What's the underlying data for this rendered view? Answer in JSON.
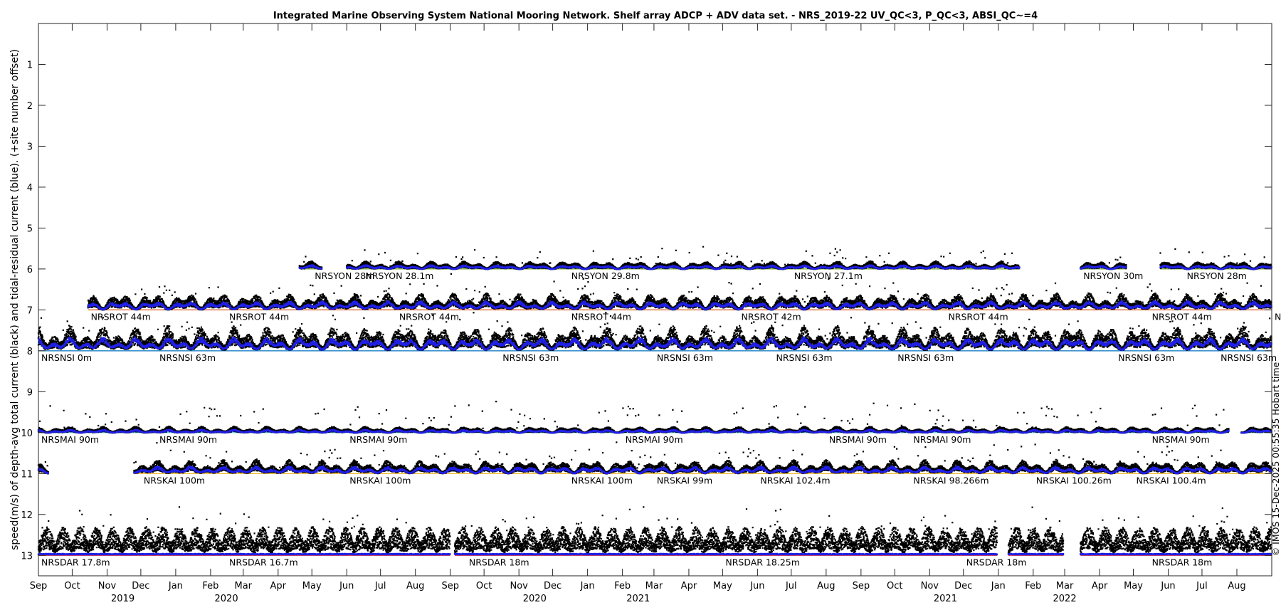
{
  "chart_data": {
    "type": "scatter",
    "title": "Integrated Marine Observing System National Mooring Network. Shelf array ADCP + ADV data set. - NRS_2019-22 UV_QC<3, P_QC<3, ABSI_QC~=4",
    "ylabel": "speed(m/s) of depth-avg total current (black) and tidal-residual current (blue). (+site number offset)",
    "right_label": "© IMOS 15-Dec-2025 00:55:35 Hobart time",
    "xlim": [
      "2019-09-01",
      "2022-09-01"
    ],
    "ylim": [
      0,
      13.5
    ],
    "y_reversed": true,
    "grid": false,
    "y_ticks": [
      1,
      2,
      3,
      4,
      5,
      6,
      7,
      8,
      9,
      10,
      11,
      12,
      13
    ],
    "x_ticks": [
      {
        "date": "2019-09-01",
        "label": "Sep"
      },
      {
        "date": "2019-10-01",
        "label": "Oct"
      },
      {
        "date": "2019-11-01",
        "label": "Nov"
      },
      {
        "date": "2019-12-01",
        "label": "Dec"
      },
      {
        "date": "2020-01-01",
        "label": "Jan"
      },
      {
        "date": "2020-02-01",
        "label": "Feb"
      },
      {
        "date": "2020-03-01",
        "label": "Mar"
      },
      {
        "date": "2020-04-01",
        "label": "Apr"
      },
      {
        "date": "2020-05-01",
        "label": "May"
      },
      {
        "date": "2020-06-01",
        "label": "Jun"
      },
      {
        "date": "2020-07-01",
        "label": "Jul"
      },
      {
        "date": "2020-08-01",
        "label": "Aug"
      },
      {
        "date": "2020-09-01",
        "label": "Sep"
      },
      {
        "date": "2020-10-01",
        "label": "Oct"
      },
      {
        "date": "2020-11-01",
        "label": "Nov"
      },
      {
        "date": "2020-12-01",
        "label": "Dec"
      },
      {
        "date": "2021-01-01",
        "label": "Jan"
      },
      {
        "date": "2021-02-01",
        "label": "Feb"
      },
      {
        "date": "2021-03-01",
        "label": "Mar"
      },
      {
        "date": "2021-04-01",
        "label": "Apr"
      },
      {
        "date": "2021-05-01",
        "label": "May"
      },
      {
        "date": "2021-06-01",
        "label": "Jun"
      },
      {
        "date": "2021-07-01",
        "label": "Jul"
      },
      {
        "date": "2021-08-01",
        "label": "Aug"
      },
      {
        "date": "2021-09-01",
        "label": "Sep"
      },
      {
        "date": "2021-10-01",
        "label": "Oct"
      },
      {
        "date": "2021-11-01",
        "label": "Nov"
      },
      {
        "date": "2021-12-01",
        "label": "Dec"
      },
      {
        "date": "2022-01-01",
        "label": "Jan"
      },
      {
        "date": "2022-02-01",
        "label": "Feb"
      },
      {
        "date": "2022-03-01",
        "label": "Mar"
      },
      {
        "date": "2022-04-01",
        "label": "Apr"
      },
      {
        "date": "2022-05-01",
        "label": "May"
      },
      {
        "date": "2022-06-01",
        "label": "Jun"
      },
      {
        "date": "2022-07-01",
        "label": "Jul"
      },
      {
        "date": "2022-08-01",
        "label": "Aug"
      }
    ],
    "year_labels": [
      {
        "date": "2019-11-15",
        "label": "2019"
      },
      {
        "date": "2020-02-15",
        "label": "2020"
      },
      {
        "date": "2020-11-15",
        "label": "2020"
      },
      {
        "date": "2021-02-15",
        "label": "2021"
      },
      {
        "date": "2021-11-15",
        "label": "2021"
      },
      {
        "date": "2022-03-01",
        "label": "2022"
      }
    ],
    "station_labels": [
      {
        "date": "2020-05-01",
        "offset": 6,
        "label": "NRSYON 28m"
      },
      {
        "date": "2020-06-15",
        "offset": 6,
        "label": "NRSYON 28.1m"
      },
      {
        "date": "2020-12-15",
        "offset": 6,
        "label": "NRSYON 29.8m"
      },
      {
        "date": "2021-07-01",
        "offset": 6,
        "label": "NRSYON 27.1m"
      },
      {
        "date": "2022-03-15",
        "offset": 6,
        "label": "NRSYON 30m"
      },
      {
        "date": "2022-06-15",
        "offset": 6,
        "label": "NRSYON 28m"
      },
      {
        "date": "2019-10-15",
        "offset": 7,
        "label": "NRSROT 44m"
      },
      {
        "date": "2020-02-15",
        "offset": 7,
        "label": "NRSROT 44m"
      },
      {
        "date": "2020-07-15",
        "offset": 7,
        "label": "NRSROT 44m"
      },
      {
        "date": "2020-12-15",
        "offset": 7,
        "label": "NRSROT 44m"
      },
      {
        "date": "2021-05-15",
        "offset": 7,
        "label": "NRSROT 42m"
      },
      {
        "date": "2021-11-15",
        "offset": 7,
        "label": "NRSROT 44m"
      },
      {
        "date": "2022-05-15",
        "offset": 7,
        "label": "NRSROT 44m"
      },
      {
        "date": "2022-09-01",
        "offset": 7,
        "label": "NRS"
      },
      {
        "date": "2019-09-01",
        "offset": 8,
        "label": "NRSNSI 0m"
      },
      {
        "date": "2019-12-15",
        "offset": 8,
        "label": "NRSNSI 63m"
      },
      {
        "date": "2020-10-15",
        "offset": 8,
        "label": "NRSNSI 63m"
      },
      {
        "date": "2021-03-01",
        "offset": 8,
        "label": "NRSNSI 63m"
      },
      {
        "date": "2021-06-15",
        "offset": 8,
        "label": "NRSNSI 63m"
      },
      {
        "date": "2021-10-01",
        "offset": 8,
        "label": "NRSNSI 63m"
      },
      {
        "date": "2022-04-15",
        "offset": 8,
        "label": "NRSNSI 63m"
      },
      {
        "date": "2022-07-15",
        "offset": 8,
        "label": "NRSNSI 63m"
      },
      {
        "date": "2019-09-01",
        "offset": 10,
        "label": "NRSMAI 90m"
      },
      {
        "date": "2019-12-15",
        "offset": 10,
        "label": "NRSMAI 90m"
      },
      {
        "date": "2020-06-01",
        "offset": 10,
        "label": "NRSMAI 90m"
      },
      {
        "date": "2021-02-01",
        "offset": 10,
        "label": "NRSMAI 90m"
      },
      {
        "date": "2021-08-01",
        "offset": 10,
        "label": "NRSMAI 90m"
      },
      {
        "date": "2021-10-15",
        "offset": 10,
        "label": "NRSMAI 90m"
      },
      {
        "date": "2022-05-15",
        "offset": 10,
        "label": "NRSMAI 90m"
      },
      {
        "date": "2019-12-01",
        "offset": 11,
        "label": "NRSKAI 100m"
      },
      {
        "date": "2020-06-01",
        "offset": 11,
        "label": "NRSKAI 100m"
      },
      {
        "date": "2020-12-15",
        "offset": 11,
        "label": "NRSKAI 100m"
      },
      {
        "date": "2021-03-01",
        "offset": 11,
        "label": "NRSKAI 99m"
      },
      {
        "date": "2021-06-01",
        "offset": 11,
        "label": "NRSKAI 102.4m"
      },
      {
        "date": "2021-10-15",
        "offset": 11,
        "label": "NRSKAI 98.266m"
      },
      {
        "date": "2022-02-01",
        "offset": 11,
        "label": "NRSKAI 100.26m"
      },
      {
        "date": "2022-05-01",
        "offset": 11,
        "label": "NRSKAI 100.4m"
      },
      {
        "date": "2019-09-01",
        "offset": 13,
        "label": "NRSDAR 17.8m"
      },
      {
        "date": "2020-02-15",
        "offset": 13,
        "label": "NRSDAR 16.7m"
      },
      {
        "date": "2020-09-15",
        "offset": 13,
        "label": "NRSDAR 18m"
      },
      {
        "date": "2021-05-01",
        "offset": 13,
        "label": "NRSDAR 18.25m"
      },
      {
        "date": "2021-12-01",
        "offset": 13,
        "label": "NRSDAR 18m"
      },
      {
        "date": "2022-05-15",
        "offset": 13,
        "label": "NRSDAR 18m"
      }
    ],
    "series": [
      {
        "name": "NRSYON",
        "offset": 6,
        "base_color": "#77ac30",
        "segments": [
          [
            "2020-04-20",
            "2020-05-10"
          ],
          [
            "2020-06-01",
            "2022-01-20"
          ],
          [
            "2022-03-15",
            "2022-04-25"
          ],
          [
            "2022-05-25",
            "2022-09-01"
          ]
        ],
        "total_speed_typical": 0.15,
        "total_speed_max": 0.7,
        "tide_period_days": 0
      },
      {
        "name": "NRSROT",
        "offset": 7,
        "base_color": "#d95319",
        "segments": [
          [
            "2019-10-15",
            "2022-09-01"
          ]
        ],
        "total_speed_typical": 0.3,
        "total_speed_max": 0.9,
        "tide_period_days": 0
      },
      {
        "name": "NRSNSI",
        "offset": 8,
        "base_color": "#0072bd",
        "segments": [
          [
            "2019-09-01",
            "2022-09-01"
          ]
        ],
        "total_speed_typical": 0.45,
        "total_speed_max": 0.95,
        "tide_period_days": 0
      },
      {
        "name": "NRSMAI",
        "offset": 10,
        "base_color": "#4dbeee",
        "segments": [
          [
            "2019-09-01",
            "2022-07-25"
          ],
          [
            "2022-08-05",
            "2022-09-01"
          ]
        ],
        "total_speed_typical": 0.12,
        "total_speed_max": 1.1,
        "tide_period_days": 0
      },
      {
        "name": "NRSKAI",
        "offset": 11,
        "base_color": "#edb120",
        "segments": [
          [
            "2019-09-01",
            "2019-09-10"
          ],
          [
            "2019-11-25",
            "2022-09-01"
          ]
        ],
        "total_speed_typical": 0.25,
        "total_speed_max": 0.9,
        "tide_period_days": 0
      },
      {
        "name": "NRSDAR",
        "offset": 13,
        "base_color": "#d62728",
        "segments": [
          [
            "2019-09-01",
            "2020-09-01"
          ],
          [
            "2020-09-05",
            "2021-12-31"
          ],
          [
            "2022-01-10",
            "2022-02-28"
          ],
          [
            "2022-03-15",
            "2022-09-01"
          ]
        ],
        "total_speed_typical": 0.6,
        "total_speed_max": 1.2,
        "tide_period_days": 14.77
      }
    ]
  }
}
